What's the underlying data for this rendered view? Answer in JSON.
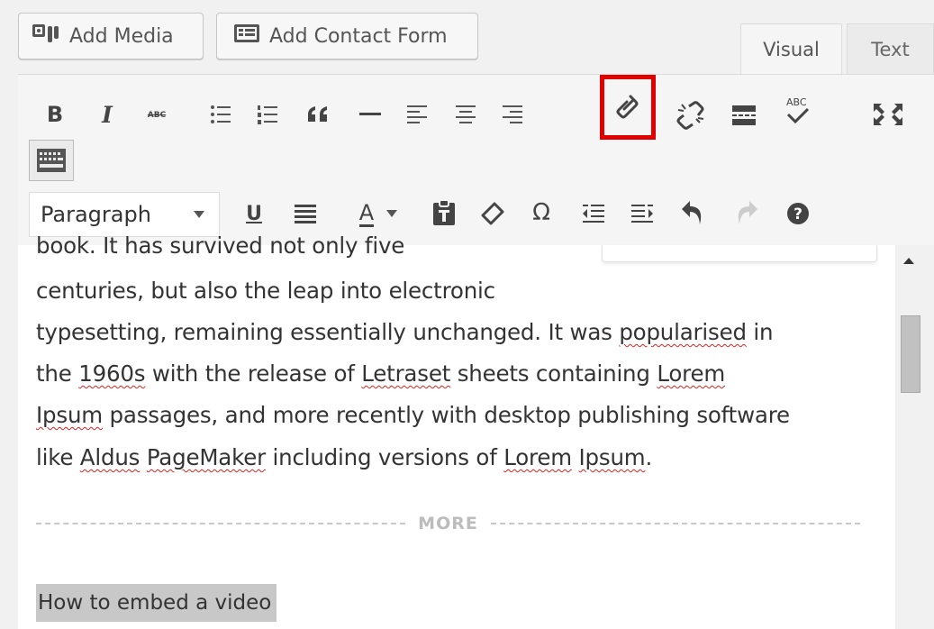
{
  "top_buttons": {
    "add_media": "Add Media",
    "add_contact_form": "Add Contact Form"
  },
  "tabs": {
    "visual": "Visual",
    "text": "Text"
  },
  "toolbar": {
    "bold": "B",
    "italic": "I",
    "strike": "ABC",
    "paragraph_select": "Paragraph",
    "underline": "U",
    "text_color": "A",
    "omega": "Ω",
    "highlighted_tool": "insert-link",
    "highlight_color": "#e00000"
  },
  "editor": {
    "partial_line": "book. It has survived not only five",
    "lines": [
      "centuries, but also the leap into electronic",
      "typesetting, remaining essentially unchanged. It was popularised in",
      "the 1960s with the release of Letraset sheets containing Lorem",
      "Ipsum passages, and more recently with desktop publishing software",
      "like Aldus PageMaker including versions of Lorem Ipsum."
    ],
    "more_label": "MORE",
    "selected_heading": "How to embed a video"
  }
}
